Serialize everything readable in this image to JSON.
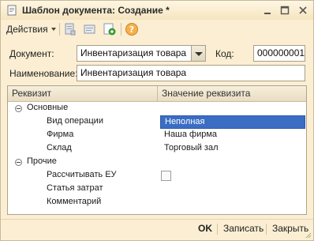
{
  "window": {
    "title": "Шаблон документа: Создание *",
    "icon": "document-window-icon"
  },
  "toolbar": {
    "actions_label": "Действия",
    "icons": [
      "save-doc-icon",
      "copy-doc-icon",
      "refresh-icon",
      "help-icon"
    ]
  },
  "form": {
    "document_label": "Документ:",
    "document_value": "Инвентаризация товара",
    "code_label": "Код:",
    "code_value": "000000001",
    "name_label": "Наименование:",
    "name_value": "Инвентаризация товара"
  },
  "grid": {
    "columns": [
      "Реквизит",
      "Значение реквизита"
    ],
    "groups": [
      {
        "label": "Основные",
        "rows": [
          {
            "name": "Вид операции",
            "value": "Неполная",
            "selected": true
          },
          {
            "name": "Фирма",
            "value": "Наша фирма"
          },
          {
            "name": "Склад",
            "value": "Торговый зал"
          }
        ]
      },
      {
        "label": "Прочие",
        "rows": [
          {
            "name": "Рассчитывать ЕУ",
            "value": "",
            "checkbox": true,
            "checked": false
          },
          {
            "name": "Статья затрат",
            "value": ""
          },
          {
            "name": "Комментарий",
            "value": ""
          }
        ]
      }
    ]
  },
  "footer": {
    "ok_label": "OK",
    "save_label": "Записать",
    "close_label": "Закрыть"
  },
  "colors": {
    "window_bg": "#fbeed2",
    "selection": "#3b6dc3"
  }
}
